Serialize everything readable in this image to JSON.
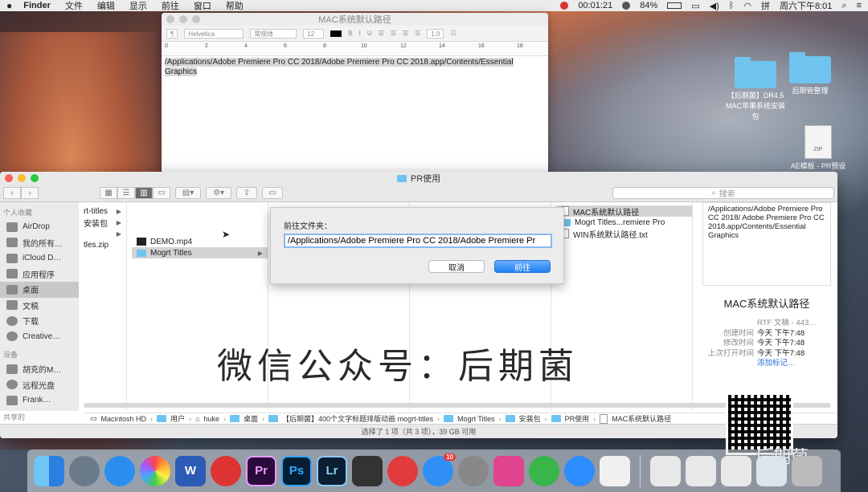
{
  "menubar": {
    "apple": "",
    "items": [
      "Finder",
      "文件",
      "编辑",
      "显示",
      "前往",
      "窗口",
      "帮助"
    ],
    "timer": "00:01:21",
    "battery": "84%",
    "datetime": "周六下午8:01"
  },
  "desktop": {
    "icon1_label": "【后期菌】DR4.5 MAC苹果系统安装包",
    "icon2_label": "后期管整理",
    "icon3_label": "AE模板 - PR预设 .zip"
  },
  "textedit": {
    "title": "MAC系统默认路径",
    "font": "Helvetica",
    "style": "常规体",
    "size": "12",
    "spacing": "1.0",
    "ruler": [
      "0",
      "2",
      "4",
      "6",
      "8",
      "10",
      "12",
      "14",
      "16",
      "18"
    ],
    "content": "/Applications/Adobe Premiere Pro CC 2018/Adobe Premiere Pro CC 2018.app/Contents/Essential Graphics"
  },
  "finder": {
    "title": "PR使用",
    "search_placeholder": "搜索",
    "sidebar": {
      "favorites_head": "个人收藏",
      "favorites": [
        "AirDrop",
        "我的所有…",
        "iCloud D…",
        "应用程序",
        "桌面",
        "文稿",
        "下载",
        "Creative…"
      ],
      "devices_head": "设备",
      "devices": [
        "胡克的M…",
        "远程光盘",
        "Frank…"
      ],
      "shared_head": "共享的"
    },
    "col1": [
      "rt-titles",
      "安装包",
      "",
      "tles.zip"
    ],
    "col2": [
      "DEMO.mp4",
      "Mogrt Titles"
    ],
    "col5": [
      "MAC系统默认路径",
      "Mogrt Titles...remiere Pro",
      "WIN系统默认路径.txt"
    ],
    "preview": {
      "doc_text": "/Applications/Adobe Premiere Pro CC 2018/ Adobe Premiere Pro CC 2018.app/Contents/Essential Graphics",
      "name": "MAC系统默认路径",
      "kind": "RTF 文稿 - 443…",
      "created_label": "创建时间",
      "created": "今天 下午7:48",
      "modified_label": "修改时间",
      "modified": "今天 下午7:48",
      "opened_label": "上次打开时间",
      "opened": "今天 下午7:48",
      "add_tags": "添加标记…"
    },
    "path": [
      "Macintosh HD",
      "用户",
      "huke",
      "桌面",
      "【后期菌】400个文字标题排版动画 mogrt-titles",
      "Mogrt Titles",
      "安装包",
      "PR使用",
      "MAC系统默认路径"
    ],
    "status": "选择了 1 项（共 3 项），39 GB 可用"
  },
  "sheet": {
    "label": "前往文件夹：",
    "value": "/Applications/Adobe Premiere Pro CC 2018/Adobe Premiere Pr",
    "cancel": "取消",
    "go": "前往"
  },
  "watermark": "微信公众号：后期菌",
  "qr_brand": "后期菌",
  "dock": {
    "appstore_badge": "10",
    "apps": [
      "finder-app",
      "launchpad-app",
      "safari-app",
      "photos-app",
      "word-app",
      "quicktime-app",
      "premiere-app",
      "photoshop-app",
      "lightroom-app",
      "finalcut-app",
      "netease-music-app",
      "appstore-app",
      "system-prefs-app",
      "cleanmymac-app",
      "wechat-app",
      "zoom-app",
      "textedit-app"
    ],
    "labels": {
      "premiere": "Pr",
      "photoshop": "Ps",
      "lightroom": "Lr",
      "word": "W"
    }
  },
  "colors": {
    "accent": "#1f7ef0",
    "folder": "#6fc4ef"
  }
}
